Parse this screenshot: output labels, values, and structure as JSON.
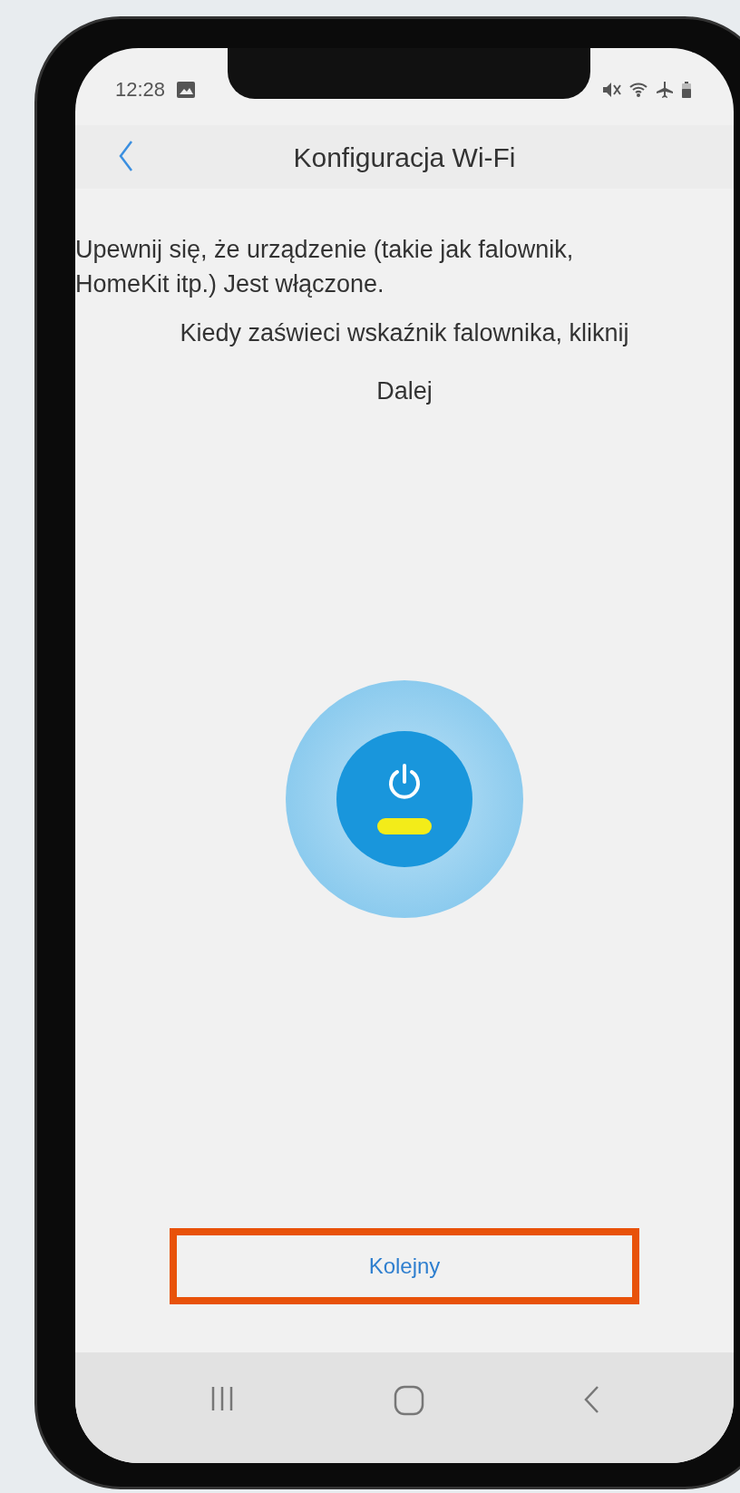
{
  "status_bar": {
    "time": "12:28"
  },
  "header": {
    "title": "Konfiguracja Wi-Fi"
  },
  "instructions": [
    {
      "text": "Upewnij się, że urządzenie (takie jak falownik, HomeKit itp.) Jest włączone.",
      "kind": "paragraph"
    },
    {
      "text": "Kiedy zaświeci wskaźnik falownika, kliknij",
      "kind": "caption"
    },
    {
      "text": "Dalej",
      "kind": "caption"
    }
  ],
  "indicator": {
    "on": true
  },
  "next_button": {
    "label": "Kolejny",
    "highlighted": true
  }
}
